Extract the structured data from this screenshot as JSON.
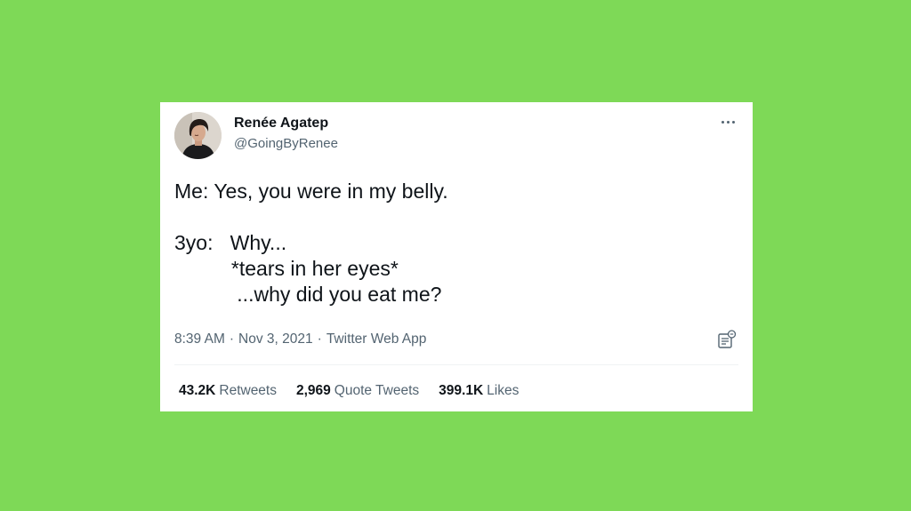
{
  "page": {
    "background_color": "#7ed957",
    "card_color": "#ffffff",
    "text_color": "#0f1419",
    "muted_color": "#536471"
  },
  "tweet": {
    "author": {
      "display_name": "Renée Agatep",
      "handle": "@GoingByRenee",
      "avatar_icon": "user-avatar"
    },
    "more_icon": "more-horizontal-icon",
    "body": {
      "line1": "Me: Yes, you were in my belly.",
      "line2": "3yo:   Why...",
      "line3": "          *tears in her eyes*",
      "line4": "           ...why did you eat me?"
    },
    "meta": {
      "time": "8:39 AM",
      "date": "Nov 3, 2021",
      "source": "Twitter Web App",
      "separator": "·"
    },
    "analytics_icon": "analytics-icon",
    "stats": {
      "retweets_count": "43.2K",
      "retweets_label": "Retweets",
      "quotes_count": "2,969",
      "quotes_label": "Quote Tweets",
      "likes_count": "399.1K",
      "likes_label": "Likes"
    }
  }
}
